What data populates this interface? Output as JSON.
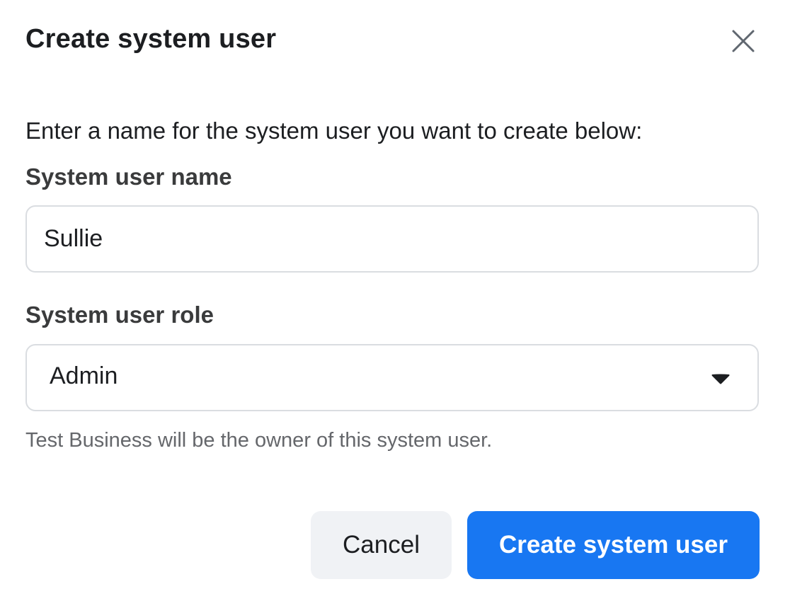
{
  "dialog": {
    "title": "Create system user",
    "close_icon": "close-icon",
    "instructions": "Enter a name for the system user you want to create below:"
  },
  "name_field": {
    "label": "System user name",
    "value": "Sullie"
  },
  "role_field": {
    "label": "System user role",
    "selected": "Admin",
    "caret_icon": "caret-down-icon"
  },
  "helper_text": "Test Business will be the owner of this system user.",
  "actions": {
    "cancel_label": "Cancel",
    "create_label": "Create system user"
  },
  "colors": {
    "primary": "#1877f2",
    "secondary_button": "#f0f2f5",
    "border": "#dadde1",
    "helper_text": "#65676b"
  }
}
